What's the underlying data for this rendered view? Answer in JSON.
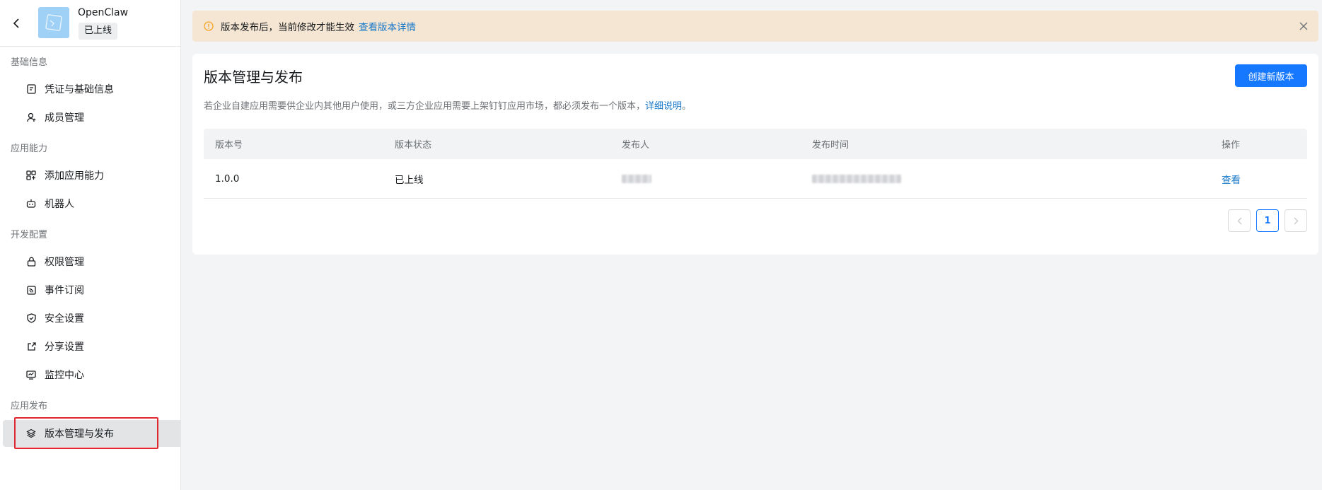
{
  "app": {
    "name": "OpenClaw",
    "status": "已上线"
  },
  "sidebar": {
    "groups": [
      {
        "title": "基础信息",
        "items": [
          {
            "label": "凭证与基础信息",
            "icon": "credential-icon"
          },
          {
            "label": "成员管理",
            "icon": "member-icon"
          }
        ]
      },
      {
        "title": "应用能力",
        "items": [
          {
            "label": "添加应用能力",
            "icon": "add-capability-icon"
          },
          {
            "label": "机器人",
            "icon": "robot-icon"
          }
        ]
      },
      {
        "title": "开发配置",
        "items": [
          {
            "label": "权限管理",
            "icon": "lock-icon"
          },
          {
            "label": "事件订阅",
            "icon": "rss-icon"
          },
          {
            "label": "安全设置",
            "icon": "shield-icon"
          },
          {
            "label": "分享设置",
            "icon": "share-icon"
          },
          {
            "label": "监控中心",
            "icon": "monitor-icon"
          }
        ]
      },
      {
        "title": "应用发布",
        "items": [
          {
            "label": "版本管理与发布",
            "icon": "layers-icon",
            "active": true
          }
        ]
      }
    ]
  },
  "notice": {
    "text": "版本发布后，当前修改才能生效",
    "link": "查看版本详情"
  },
  "main": {
    "title": "版本管理与发布",
    "description": "若企业自建应用需要供企业内其他用户使用，或三方企业应用需要上架钉钉应用市场，都必须发布一个版本，",
    "description_link": "详细说明",
    "description_end": "。",
    "create_button": "创建新版本",
    "table": {
      "columns": [
        "版本号",
        "版本状态",
        "发布人",
        "发布时间",
        "操作"
      ],
      "rows": [
        {
          "version": "1.0.0",
          "status": "已上线",
          "publisher": "",
          "time": "",
          "action": "查看"
        }
      ]
    },
    "pagination": {
      "current": "1"
    }
  },
  "colors": {
    "primary": "#1677ff",
    "link": "#1677c8",
    "notice_bg": "#f5e6d4",
    "warn": "#f5a524",
    "highlight": "#e0282e"
  }
}
